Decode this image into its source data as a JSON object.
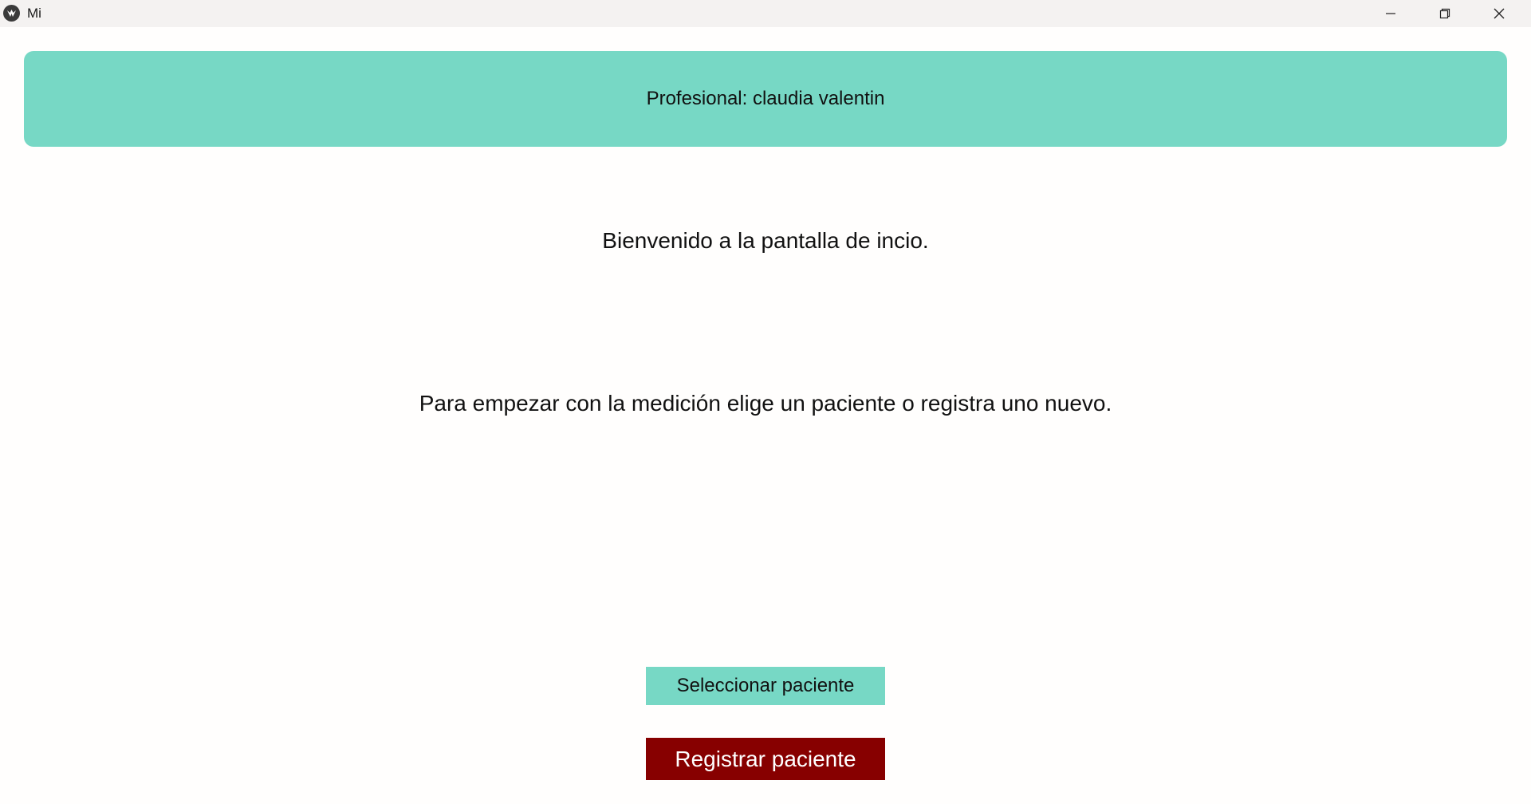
{
  "window": {
    "title": "Mi",
    "icon": "kivy-logo-icon",
    "controls": [
      "minimize-icon",
      "restore-icon",
      "close-icon"
    ]
  },
  "header": {
    "professional_label": "Profesional: claudia valentin"
  },
  "main": {
    "welcome": "Bienvenido a la pantalla de incio.",
    "instructions": "Para empezar con la medición elige un paciente o registra uno nuevo."
  },
  "actions": {
    "select_patient": "Seleccionar paciente",
    "register_patient": "Registrar paciente"
  },
  "colors": {
    "accent": "#77d8c5",
    "danger": "#870000",
    "background": "#fffefd"
  }
}
